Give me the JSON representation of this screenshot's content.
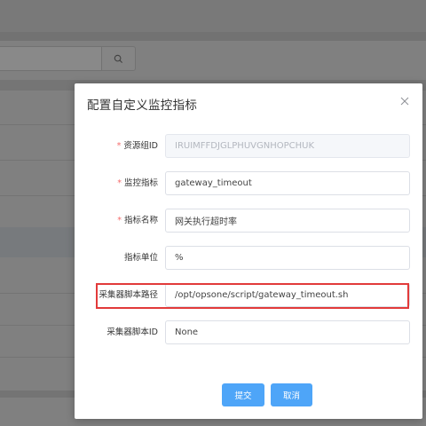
{
  "dialog": {
    "title": "配置自定义监控指标",
    "close_symbol": "×"
  },
  "form": {
    "fields": [
      {
        "label": "资源组ID",
        "required": true,
        "value": "IRUIMFFDJGLPHUVGNHOPCHUK",
        "disabled": true
      },
      {
        "label": "监控指标",
        "required": true,
        "value": "gateway_timeout",
        "disabled": false
      },
      {
        "label": "指标名称",
        "required": true,
        "value": "网关执行超时率",
        "disabled": false
      },
      {
        "label": "指标单位",
        "required": false,
        "value": "%",
        "disabled": false
      },
      {
        "label": "采集器脚本路径",
        "required": false,
        "value": "/opt/opsone/script/gateway_timeout.sh",
        "disabled": false,
        "highlighted": true
      },
      {
        "label": "采集器脚本ID",
        "required": false,
        "value": "None",
        "disabled": false
      }
    ],
    "required_mark": "*"
  },
  "actions": {
    "submit_label": "提交",
    "cancel_label": "取消"
  },
  "background": {
    "search_icon": "search-icon"
  },
  "colors": {
    "primary": "#4ea5f8",
    "required": "#f56c6c",
    "highlight": "#e23a3a"
  }
}
